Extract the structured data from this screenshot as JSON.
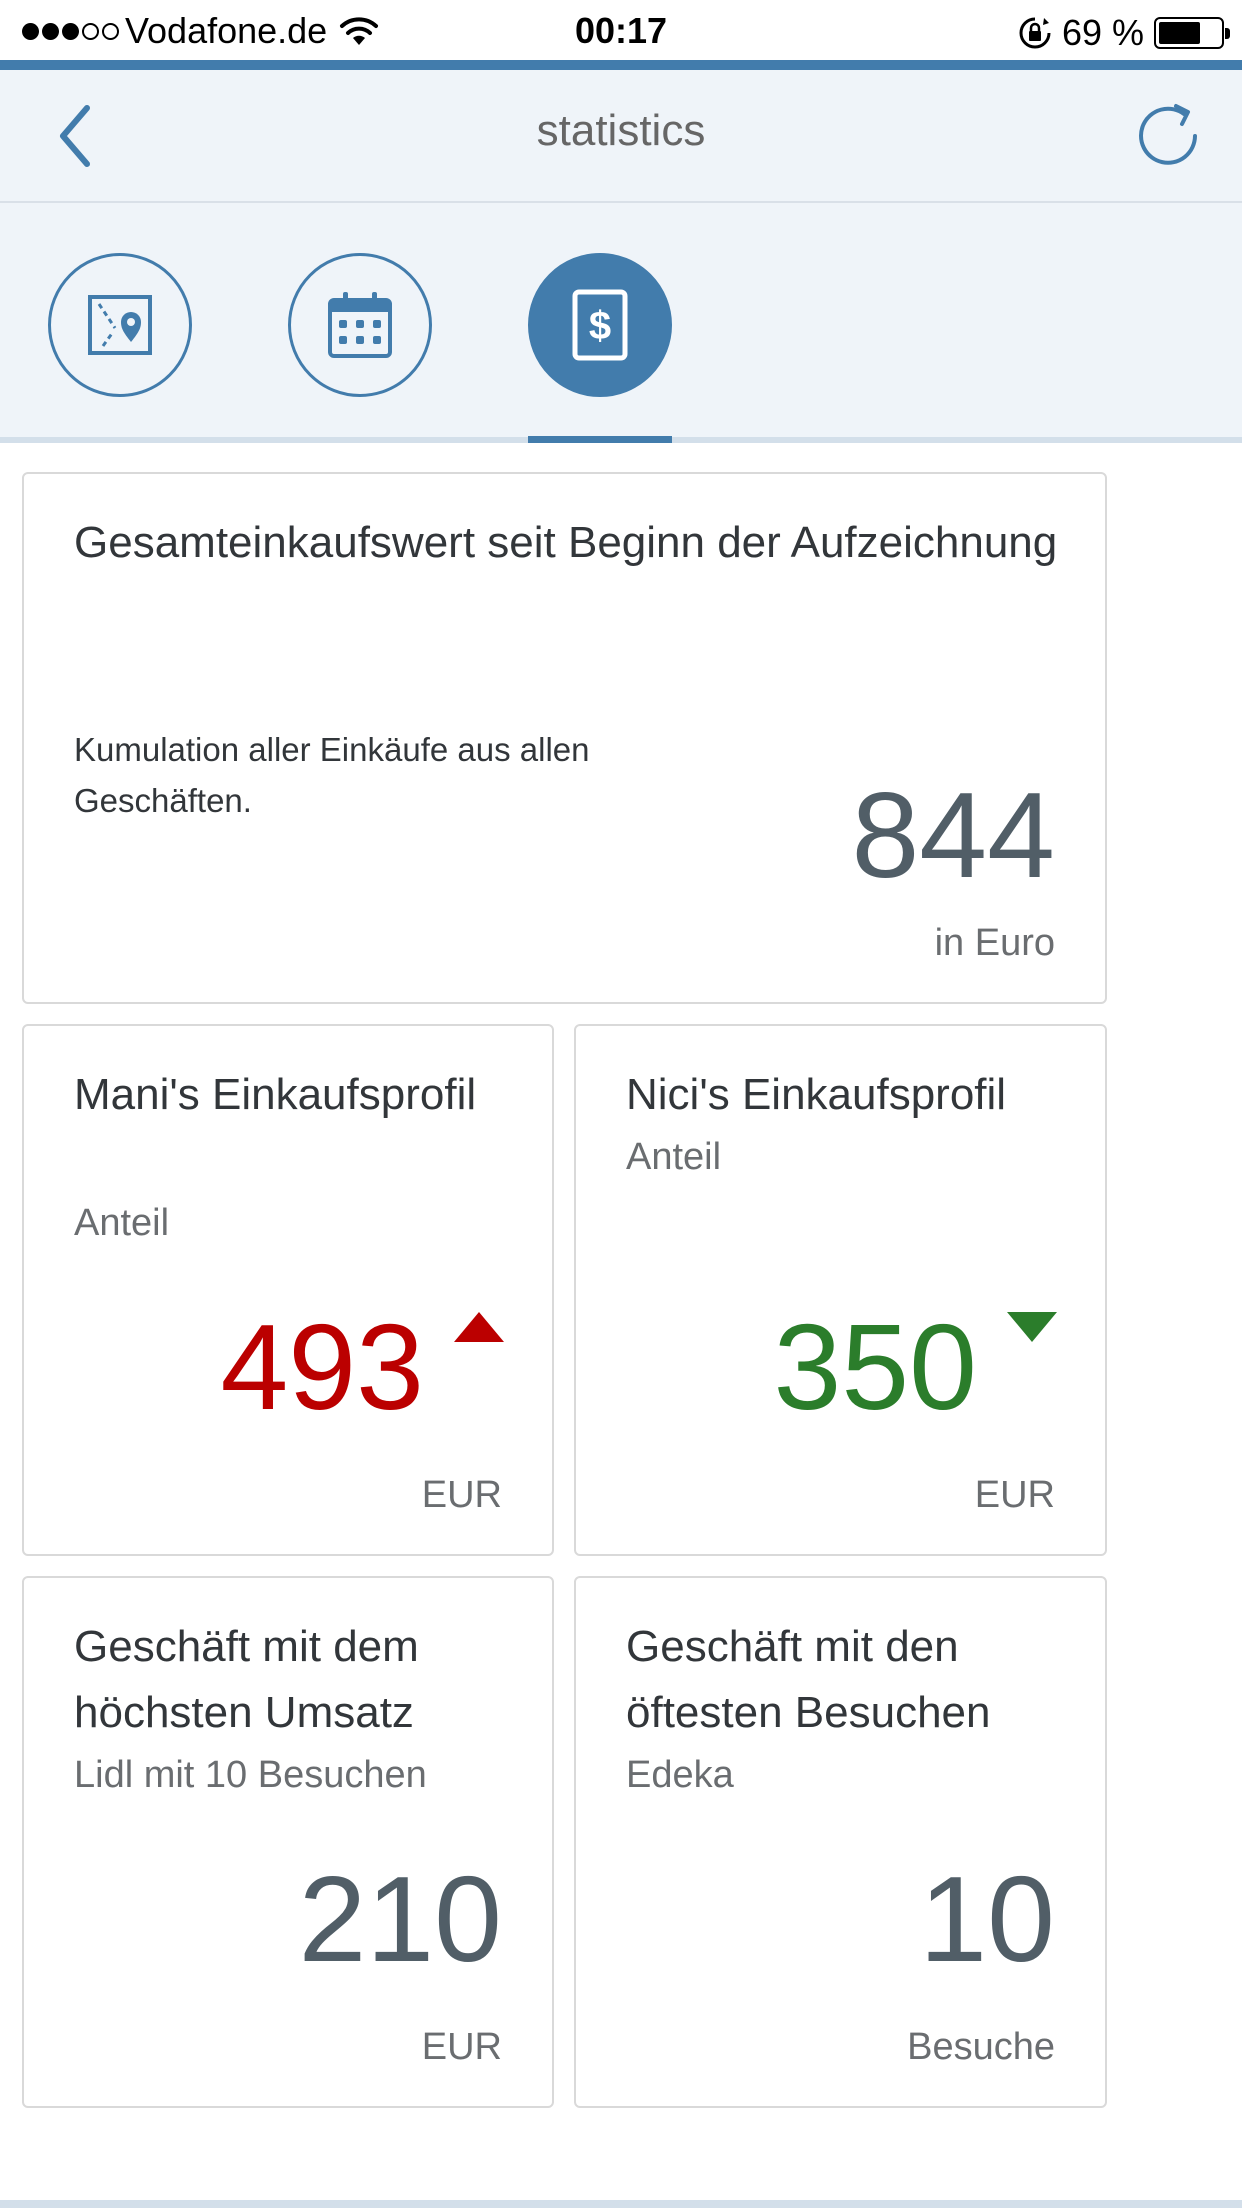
{
  "status_bar": {
    "carrier": "Vodafone.de",
    "signal_filled": 3,
    "signal_total": 5,
    "time": "00:17",
    "battery_percent": "69 %",
    "battery_level": 0.69
  },
  "header": {
    "title": "statistics",
    "back_icon": "chevron-left-icon",
    "refresh_icon": "refresh-icon"
  },
  "tabs": [
    {
      "icon": "map-icon",
      "selected": false
    },
    {
      "icon": "calendar-icon",
      "selected": false
    },
    {
      "icon": "dollar-document-icon",
      "selected": true
    }
  ],
  "tiles": {
    "total": {
      "header": "Gesamteinkaufswert seit Beginn der Aufzeichnung",
      "description": "Kumulation aller Einkäufe aus allen Geschäften.",
      "value": "844",
      "unit": "in Euro"
    },
    "mani": {
      "header": "Mani's Einkaufsprofil",
      "subheader": "Anteil",
      "value": "493",
      "unit": "EUR",
      "trend": "up"
    },
    "nici": {
      "header": "Nici's Einkaufsprofil",
      "subheader": "Anteil",
      "value": "350",
      "unit": "EUR",
      "trend": "down"
    },
    "top_revenue": {
      "header": "Geschäft mit dem höchsten Umsatz",
      "subheader": "Lidl mit 10 Besuchen",
      "value": "210",
      "unit": "EUR"
    },
    "top_visits": {
      "header": "Geschäft mit den öftesten Besuchen",
      "subheader": "Edeka",
      "value": "10",
      "unit": "Besuche"
    }
  },
  "colors": {
    "accent": "#427cac",
    "header_bg": "#eff4f9",
    "negative": "#bb0000",
    "positive": "#2b7d2b",
    "kpi_neutral": "#515e67"
  }
}
